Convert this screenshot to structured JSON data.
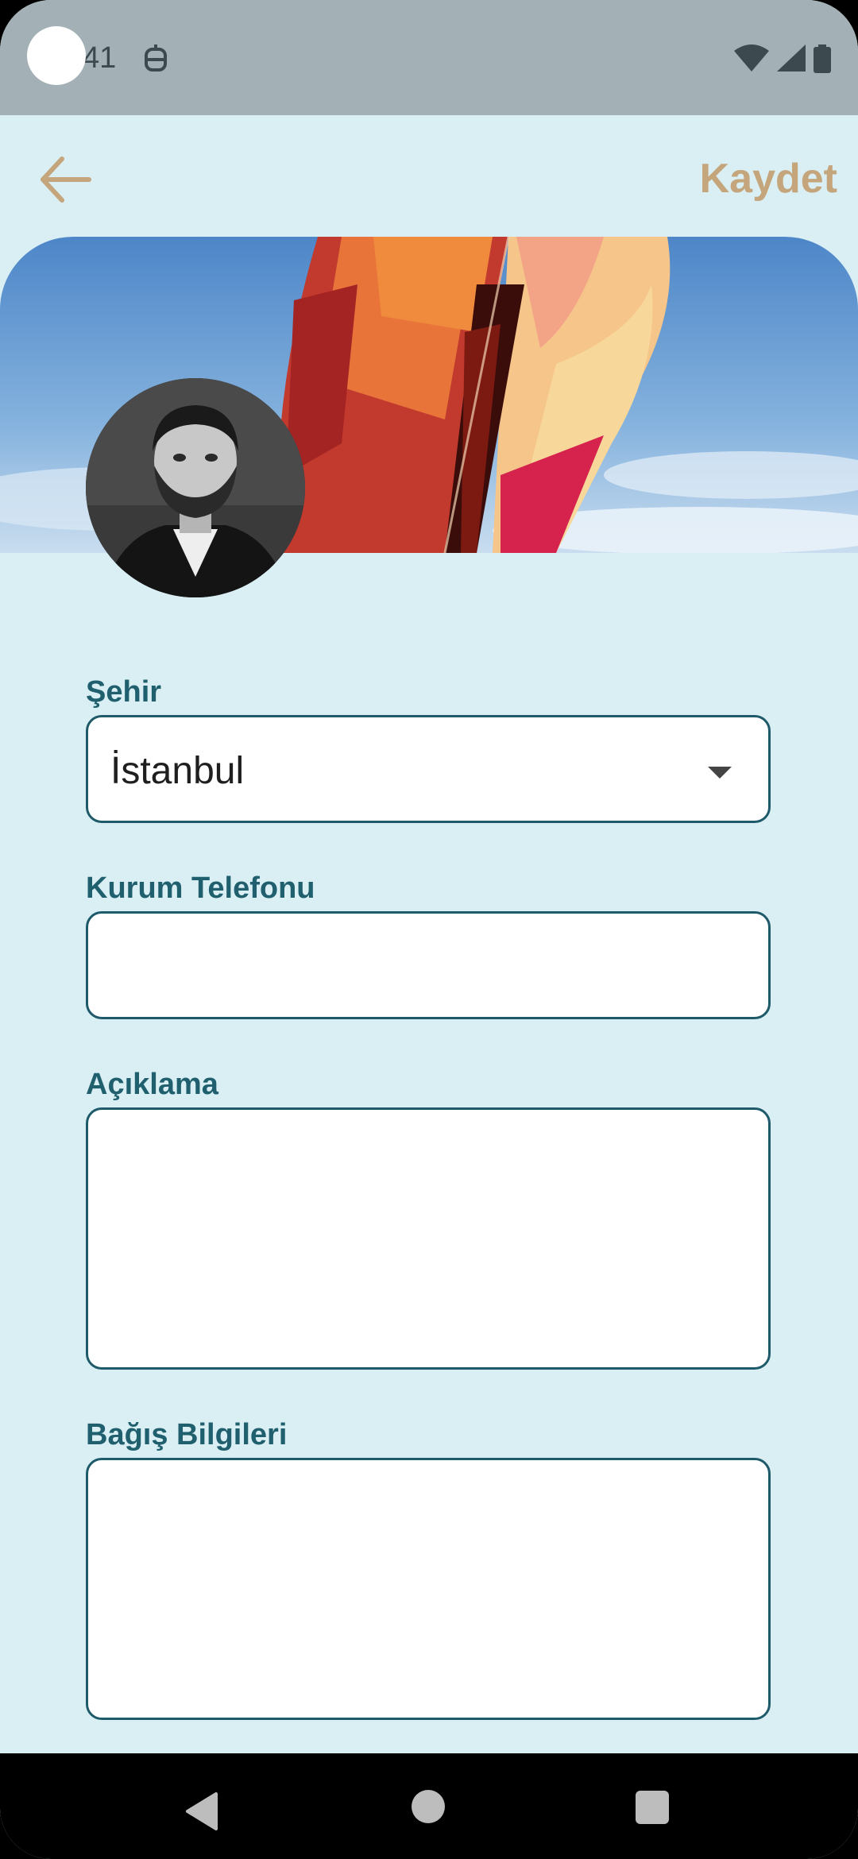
{
  "status_bar": {
    "time": "41",
    "icons": [
      "notification-icon",
      "wifi-icon",
      "cellular-icon",
      "battery-icon"
    ]
  },
  "header": {
    "back_icon": "arrow-left-icon",
    "save_label": "Kaydet"
  },
  "colors": {
    "background": "#d9eff4",
    "accent": "#c4a57c",
    "label": "#205f6e",
    "field_border": "#1f5a6a"
  },
  "form": {
    "city": {
      "label": "Şehir",
      "value": "İstanbul"
    },
    "phone": {
      "label": "Kurum Telefonu",
      "value": ""
    },
    "description": {
      "label": "Açıklama",
      "value": ""
    },
    "donation": {
      "label": "Bağış Bilgileri",
      "value": ""
    }
  },
  "nav_bar": {
    "icons": [
      "nav-back-icon",
      "nav-home-icon",
      "nav-recents-icon"
    ]
  }
}
